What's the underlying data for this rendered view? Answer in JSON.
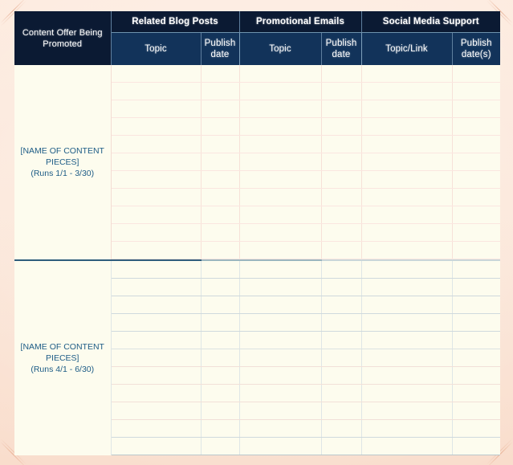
{
  "document": {
    "kind": "content-promotion-planning-table",
    "sheet_background": "#fdfcee",
    "paper_border": "#fbe6d8",
    "header_dark": "#0b1a33",
    "header_sub": "#12335a",
    "label_text_color": "#1d5c86"
  },
  "table": {
    "corner_header": "Content Offer Being Promoted",
    "groups": [
      {
        "label": "Related Blog Posts"
      },
      {
        "label": "Promotional Emails"
      },
      {
        "label": "Social Media Support"
      }
    ],
    "subheaders": [
      "Topic",
      "Publish date",
      "Topic",
      "Publish date",
      "Topic/Link",
      "Publish date(s)"
    ],
    "sections": [
      {
        "name_line1": "[NAME OF CONTENT",
        "name_line2": "PIECES]",
        "runs": "(Runs 1/1 - 3/30)",
        "row_count": 11
      },
      {
        "name_line1": "[NAME OF CONTENT",
        "name_line2": "PIECES]",
        "runs": "(Runs 4/1 - 6/30)",
        "row_count": 11
      }
    ]
  }
}
